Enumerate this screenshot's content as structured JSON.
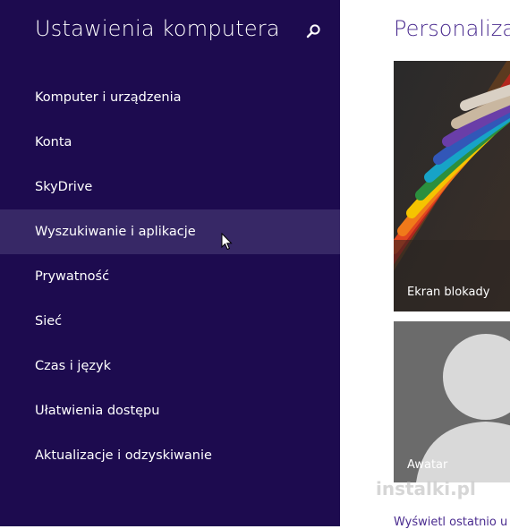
{
  "sidebar": {
    "title": "Ustawienia komputera",
    "search_icon": "search-icon",
    "items": [
      {
        "label": "Komputer i urządzenia"
      },
      {
        "label": "Konta"
      },
      {
        "label": "SkyDrive"
      },
      {
        "label": "Wyszukiwanie i aplikacje"
      },
      {
        "label": "Prywatność"
      },
      {
        "label": "Sieć"
      },
      {
        "label": "Czas i język"
      },
      {
        "label": "Ułatwienia dostępu"
      },
      {
        "label": "Aktualizacje i odzyskiwanie"
      }
    ],
    "hovered_item": "Wyszukiwanie i aplikacje"
  },
  "main": {
    "title": "Personalizac",
    "tiles": [
      {
        "label": "Ekran blokady"
      },
      {
        "label": "Awatar"
      }
    ],
    "bottom_link": "Wyświetl ostatnio u"
  },
  "watermark": "instalki.pl",
  "colors": {
    "sidebar_bg": "#1d0b4f",
    "hover_bg": "#372866",
    "accent": "#4a2b8f"
  }
}
